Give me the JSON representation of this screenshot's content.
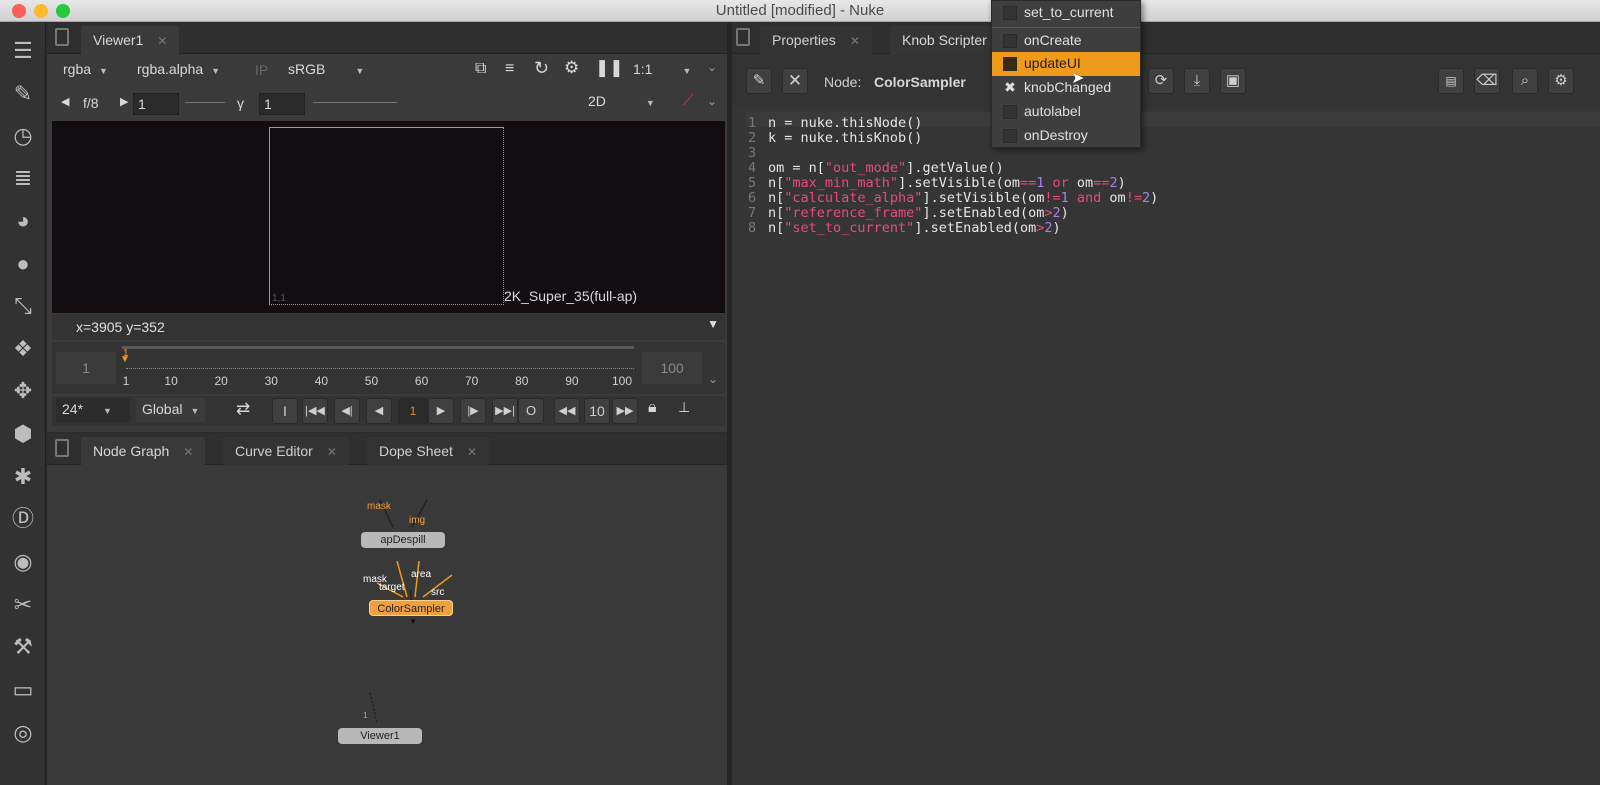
{
  "window": {
    "title": "Untitled [modified] - Nuke"
  },
  "viewer_panel": {
    "tab": "Viewer1",
    "channels": "rgba",
    "alpha_channel": "rgba.alpha",
    "ip_label": "IP",
    "colorspace": "sRGB",
    "zoom": "1:1",
    "fstop": "f/8",
    "gain_value": "1",
    "gamma_label": "γ",
    "gamma_value": "1",
    "view_mode": "2D",
    "format_label": "2K_Super_35(full-ap)",
    "frame_corner": "1,1",
    "coords": "x=3905 y=352"
  },
  "timeline": {
    "start": "1",
    "end": "100",
    "current": "1",
    "ticks": [
      "1",
      "10",
      "20",
      "30",
      "40",
      "50",
      "60",
      "70",
      "80",
      "90",
      "100"
    ],
    "fps": "24*",
    "scope": "Global",
    "step": "10",
    "in_label": "I",
    "out_label": "O"
  },
  "graph_panel": {
    "tabs": [
      "Node Graph",
      "Curve Editor",
      "Dope Sheet"
    ],
    "nodes": {
      "despill": "apDespill",
      "sampler": "ColorSampler",
      "viewer": "Viewer1"
    },
    "inputs": {
      "mask1": "mask",
      "img": "img",
      "mask2": "mask",
      "target": "target",
      "area": "area",
      "src": "src",
      "viewer_input": "1"
    }
  },
  "properties_panel": {
    "tabs": [
      "Properties",
      "Knob Scripter"
    ],
    "node_label": "Node:",
    "node_name": "ColorSampler"
  },
  "code_lines": [
    [
      "1",
      [
        [
          "w",
          "n = nuke.thisNode()"
        ]
      ]
    ],
    [
      "2",
      [
        [
          "w",
          "k = nuke.thisKnob()"
        ]
      ]
    ],
    [
      "3",
      []
    ],
    [
      "4",
      [
        [
          "w",
          "om = n["
        ],
        [
          "s",
          "\"out_mode\""
        ],
        [
          "w",
          "].getValue()"
        ]
      ]
    ],
    [
      "5",
      [
        [
          "w",
          "n["
        ],
        [
          "s",
          "\"max_min_math\""
        ],
        [
          "w",
          "].setVisible(om"
        ],
        [
          "k",
          "=="
        ],
        [
          "n",
          "1"
        ],
        [
          "w",
          " "
        ],
        [
          "k",
          "or"
        ],
        [
          "w",
          " om"
        ],
        [
          "k",
          "=="
        ],
        [
          "n",
          "2"
        ],
        [
          "w",
          ")"
        ]
      ]
    ],
    [
      "6",
      [
        [
          "w",
          "n["
        ],
        [
          "s",
          "\"calculate_alpha\""
        ],
        [
          "w",
          "].setVisible(om"
        ],
        [
          "k",
          "!="
        ],
        [
          "n",
          "1"
        ],
        [
          "w",
          " "
        ],
        [
          "k",
          "and"
        ],
        [
          "w",
          " om"
        ],
        [
          "k",
          "!="
        ],
        [
          "n",
          "2"
        ],
        [
          "w",
          ")"
        ]
      ]
    ],
    [
      "7",
      [
        [
          "w",
          "n["
        ],
        [
          "s",
          "\"reference_frame\""
        ],
        [
          "w",
          "].setEnabled(om"
        ],
        [
          "k",
          ">"
        ],
        [
          "n",
          "2"
        ],
        [
          "w",
          ")"
        ]
      ]
    ],
    [
      "8",
      [
        [
          "w",
          "n["
        ],
        [
          "s",
          "\"set_to_current\""
        ],
        [
          "w",
          "].setEnabled(om"
        ],
        [
          "k",
          ">"
        ],
        [
          "n",
          "2"
        ],
        [
          "w",
          ")"
        ]
      ]
    ]
  ],
  "knob_dropdown": {
    "items": [
      "set_to_current",
      "onCreate",
      "updateUI",
      "knobChanged",
      "autolabel",
      "onDestroy"
    ],
    "selected": "updateUI",
    "checked": "knobChanged"
  },
  "colors": {
    "accent": "#f09a1c",
    "node_default": "#b8b8b8",
    "node_selected": "#f0a040"
  }
}
